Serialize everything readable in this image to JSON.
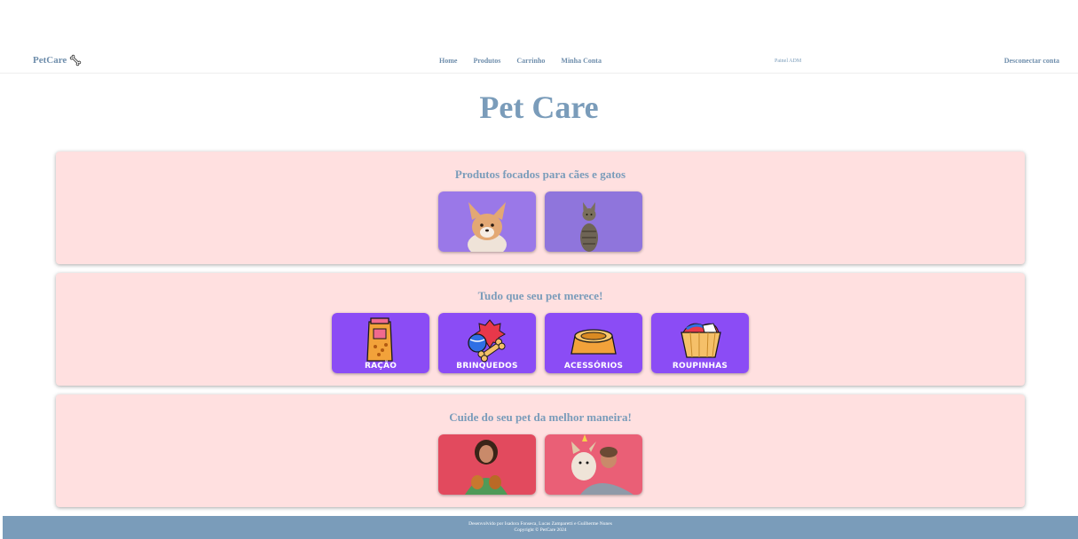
{
  "nav": {
    "brand": "PetCare",
    "brand_icon": "bone-icon",
    "links": [
      "Home",
      "Produtos",
      "Carrinho",
      "Minha Conta"
    ],
    "admin": "Painel ADM",
    "logout": "Desconectar conta"
  },
  "main": {
    "title": "Pet Care",
    "sections": [
      {
        "title": "Produtos focados para cães e gatos",
        "cards": [
          "dog-photo",
          "cat-photo"
        ]
      },
      {
        "title": "Tudo que seu pet merece!",
        "cards": [
          {
            "label": "RAÇÃO",
            "icon": "food-bag-icon"
          },
          {
            "label": "BRINQUEDOS",
            "icon": "toys-icon"
          },
          {
            "label": "ACESSÓRIOS",
            "icon": "bowl-icon"
          },
          {
            "label": "ROUPINHAS",
            "icon": "clothes-basket-icon"
          }
        ]
      },
      {
        "title": "Cuide do seu pet da melhor maneira!",
        "cards": [
          "woman-with-puppies-photo",
          "woman-with-dog-photo"
        ]
      }
    ]
  },
  "footer": {
    "line1": "Desenvolvido por Isadora Fonseca, Lucas Zamparetti e Guilherme Nunes",
    "line2": "Copyright © PetCare 2024"
  },
  "colors": {
    "accent": "#7a9cba",
    "section_bg": "#ffe0e0",
    "card_purple": "#8b4cf5",
    "card_pink": "#e24a5e"
  }
}
